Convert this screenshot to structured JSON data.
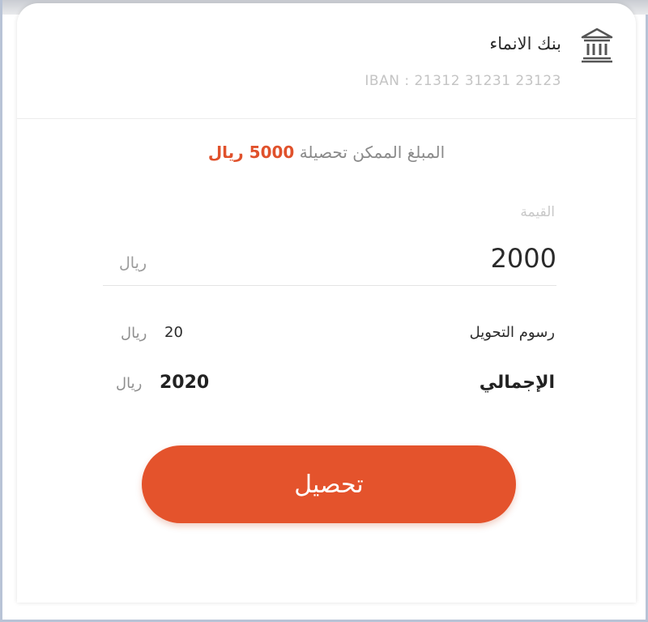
{
  "bank": {
    "name": "بنك الانماء",
    "iban": "IBAN : 21312 31231 23123",
    "icon": "bank-icon"
  },
  "available": {
    "prefix": "المبلغ الممكن تحصيلة",
    "amount": "5000 ريال"
  },
  "value_field": {
    "label": "القيمة",
    "value": "2000",
    "currency": "ريال"
  },
  "fees": {
    "label": "رسوم التحويل",
    "value": "20",
    "currency": "ريال"
  },
  "total": {
    "label": "الإجمالي",
    "value": "2020",
    "currency": "ريال"
  },
  "action": {
    "label": "تحصيل",
    "color": "#e4532c"
  }
}
